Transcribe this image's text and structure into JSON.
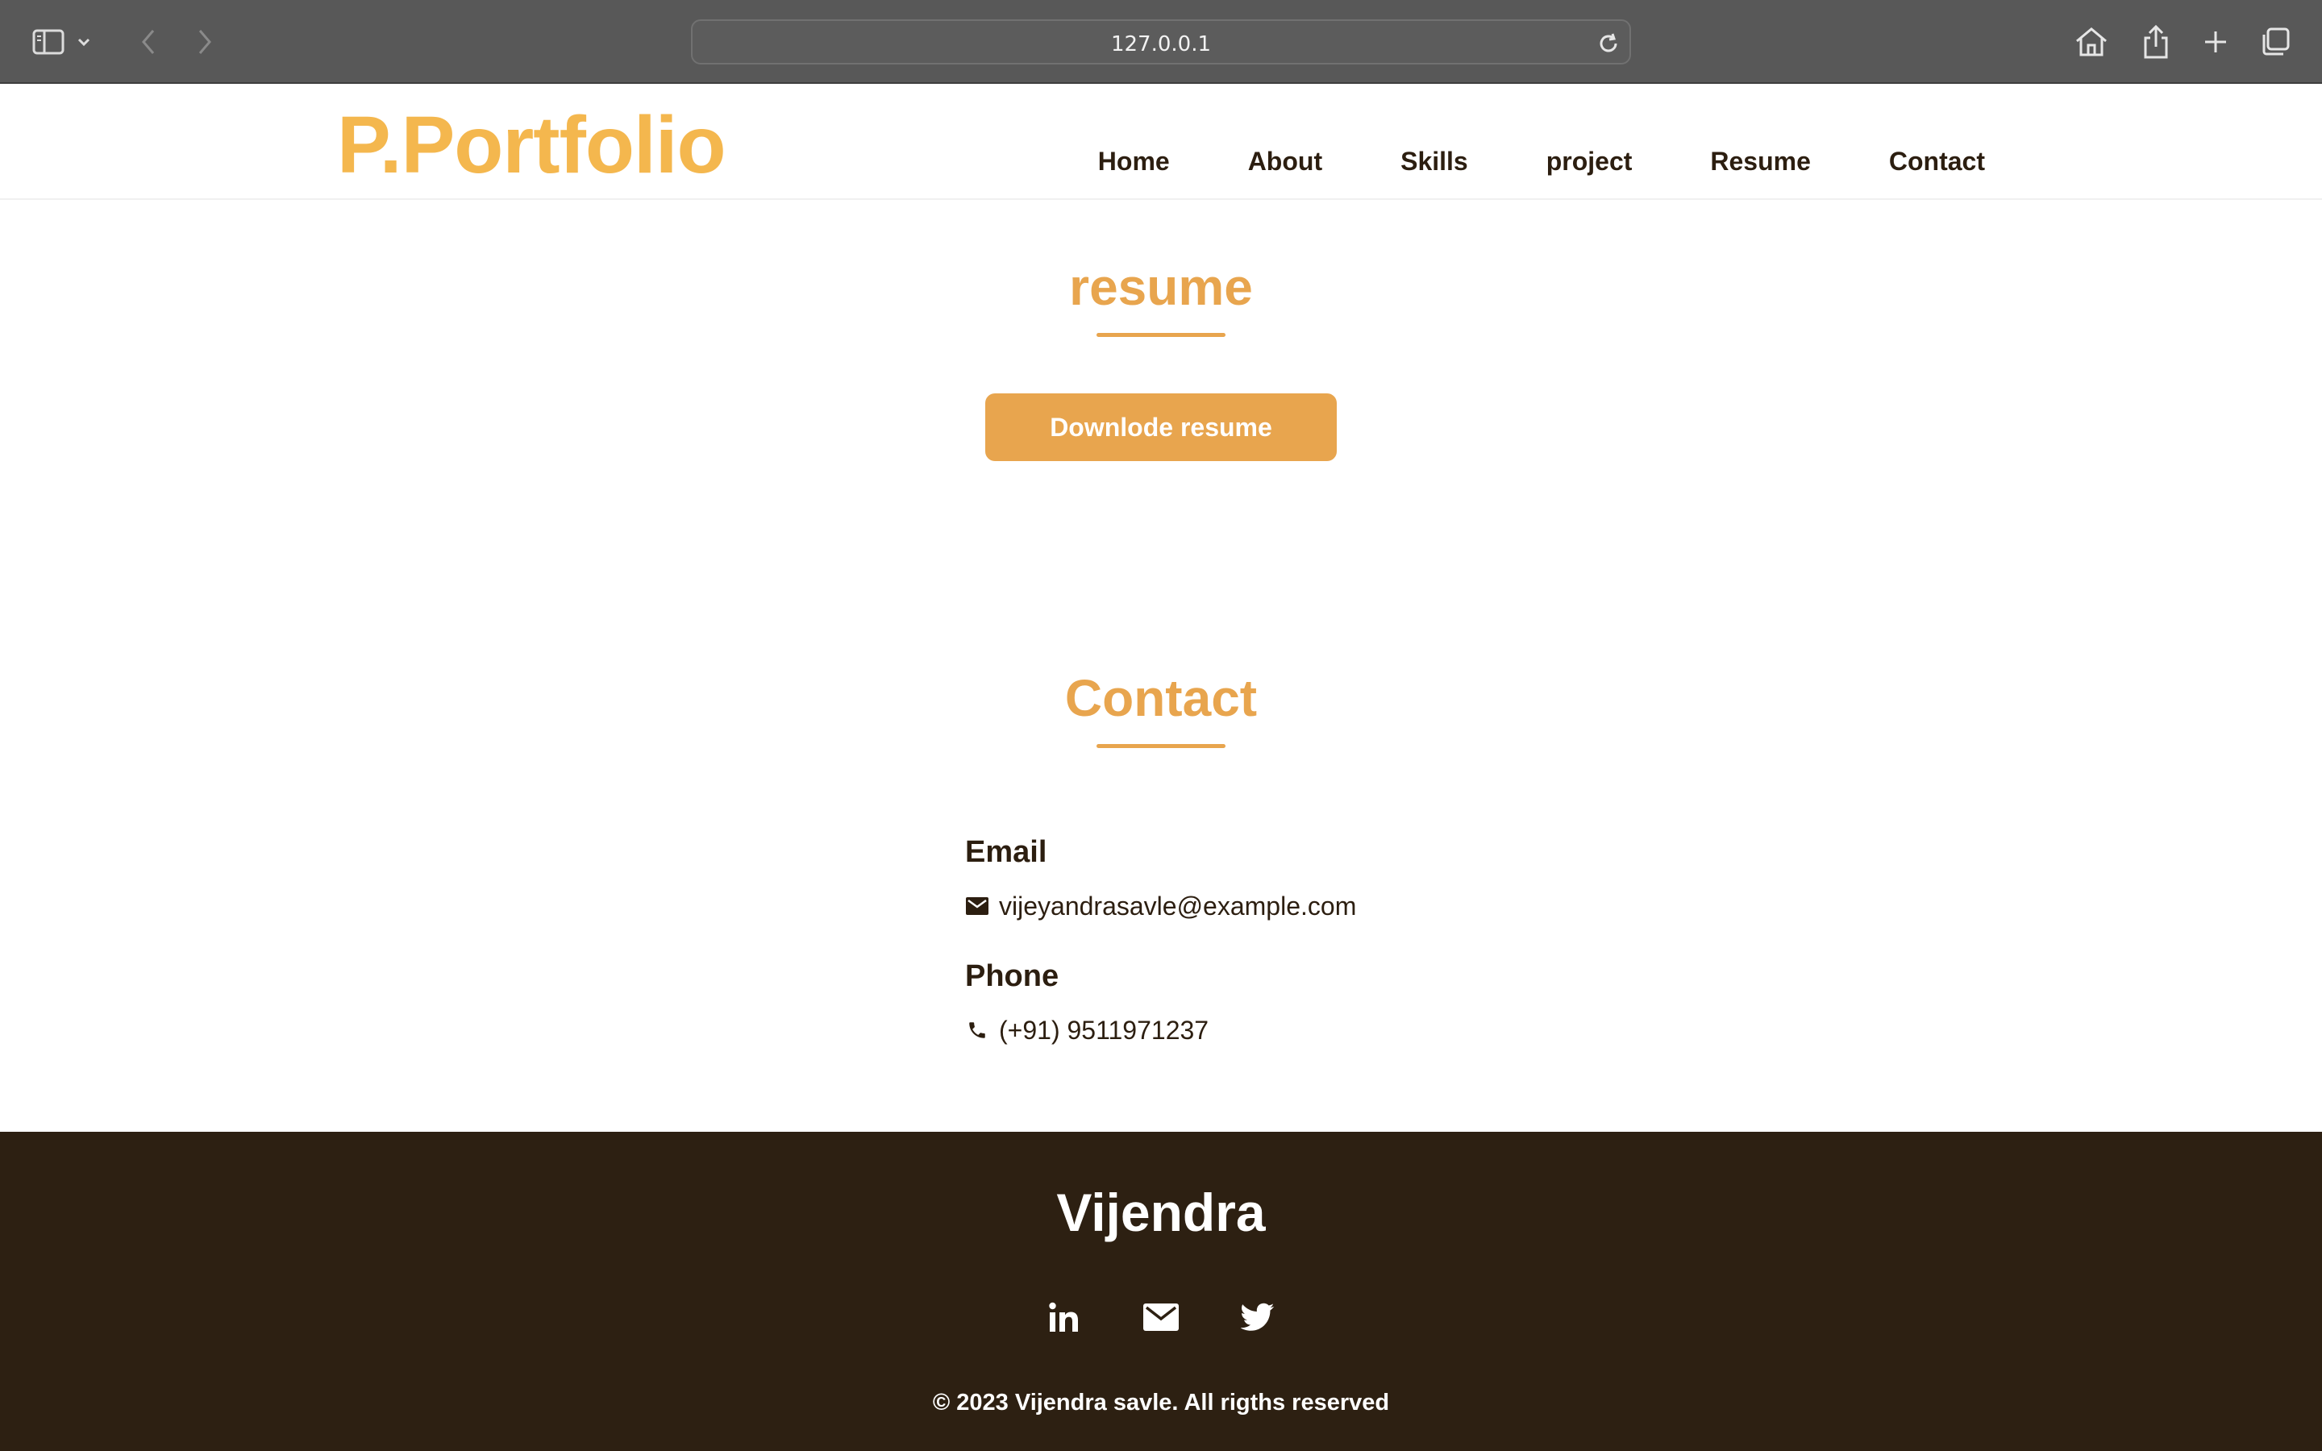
{
  "browser": {
    "url": "127.0.0.1",
    "icons": [
      "sidebar-icon",
      "chevron-down-icon",
      "back-icon",
      "forward-icon",
      "reload-icon",
      "home-icon",
      "share-icon",
      "new-tab-icon",
      "tabs-overview-icon"
    ]
  },
  "header": {
    "logo": "P.Portfolio",
    "nav": [
      "Home",
      "About",
      "Skills",
      "project",
      "Resume",
      "Contact"
    ]
  },
  "resume": {
    "title": "resume",
    "button_label": "Downlode resume"
  },
  "contact": {
    "title": "Contact",
    "email_heading": "Email",
    "email": "vijeyandrasavle@example.com",
    "phone_heading": "Phone",
    "phone": "(+91) 9511971237"
  },
  "footer": {
    "name": "Vijendra",
    "socials": [
      "linkedin-icon",
      "mail-icon",
      "twitter-icon"
    ],
    "copyright": "© 2023 Vijendra savle. All rigths reserved"
  },
  "colors": {
    "accent": "#e8a54e",
    "logo": "#f4b74e",
    "dark": "#2d2012",
    "chrome": "#585858"
  }
}
